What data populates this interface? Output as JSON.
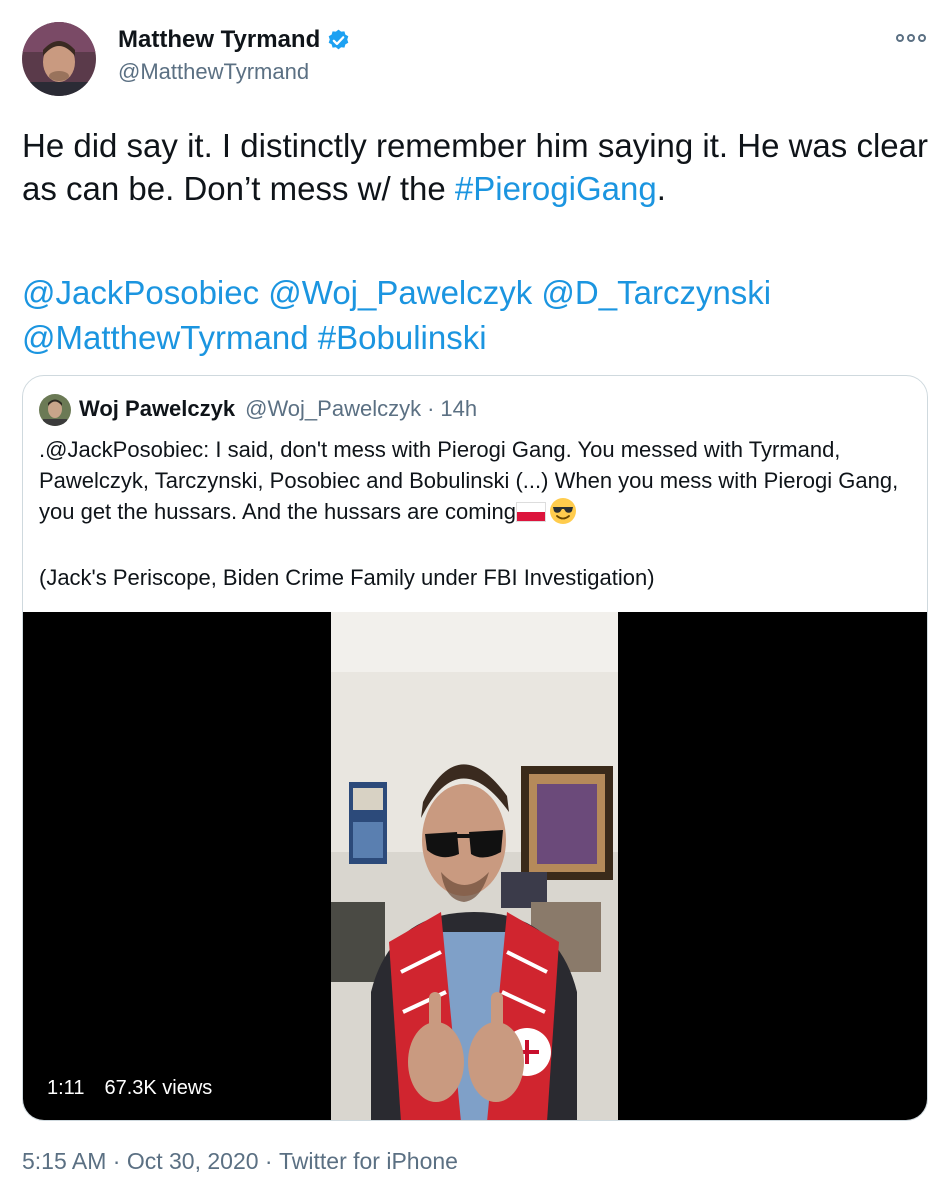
{
  "author": {
    "name": "Matthew Tyrmand",
    "handle": "@MatthewTyrmand",
    "verified": true,
    "avatar_icon": "profile-photo"
  },
  "tweet": {
    "text_before": "He did say it. I distinctly remember him saying it. He was clear as can be. Don’t mess w/ the ",
    "hashtag": "#PierogiGang",
    "text_after": ".",
    "mentions": [
      "@JackPosobiec",
      "@Woj_Pawelczyk",
      "@D_Tarczynski",
      "@MatthewTyrmand",
      "#Bobulinski"
    ]
  },
  "quoted": {
    "name": "Woj Pawelczyk",
    "handle": "@Woj_Pawelczyk",
    "separator": "·",
    "time": "14h",
    "text": ".@JackPosobiec: I said, don't mess with Pierogi Gang. You messed with Tyrmand, Pawelczyk, Tarczynski, Posobiec and Bobulinski (...) When you mess with Pierogi Gang, you get the hussars. And the hussars are coming",
    "text2": "(Jack's Periscope, Biden Crime Family under FBI Investigation)",
    "emojis": [
      "poland-flag-emoji",
      "smiling-face-with-sunglasses-emoji"
    ],
    "video": {
      "duration": "1:11",
      "views": "67.3K views"
    }
  },
  "footer": {
    "time": "5:15 AM",
    "sep1": " · ",
    "date": "Oct 30, 2020",
    "sep2": " · ",
    "source": "Twitter for iPhone"
  },
  "colors": {
    "link": "#1b95e0",
    "secondary": "#5b7083",
    "verified": "#1da1f2",
    "border": "#cfd9de"
  }
}
